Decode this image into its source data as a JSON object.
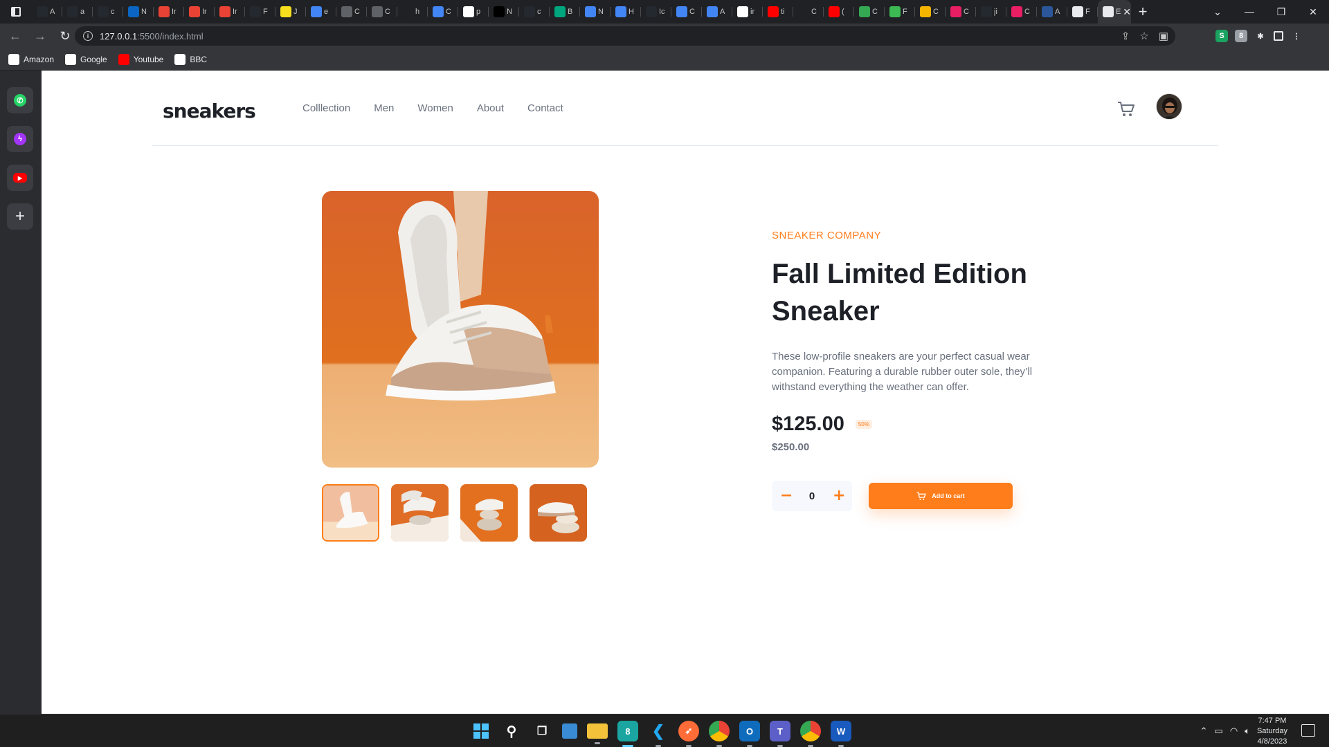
{
  "browser": {
    "tabs": [
      {
        "label": "A",
        "icon": "github-icon",
        "color": "#24292f"
      },
      {
        "label": "a",
        "icon": "github-icon",
        "color": "#24292f"
      },
      {
        "label": "c",
        "icon": "github-icon",
        "color": "#24292f"
      },
      {
        "label": "N",
        "icon": "linkedin-icon",
        "color": "#0a66c2"
      },
      {
        "label": "Ir",
        "icon": "gmail-icon",
        "color": "#ea4335"
      },
      {
        "label": "Ir",
        "icon": "gmail-icon",
        "color": "#ea4335"
      },
      {
        "label": "Ir",
        "icon": "gmail-icon",
        "color": "#ea4335"
      },
      {
        "label": "F",
        "icon": "github-icon",
        "color": "#24292f"
      },
      {
        "label": "J",
        "icon": "js-icon",
        "color": "#f7df1e"
      },
      {
        "label": "e",
        "icon": "globe-icon",
        "color": "#4285f4"
      },
      {
        "label": "C",
        "icon": "doc-icon",
        "color": "#5f6368"
      },
      {
        "label": "C",
        "icon": "doc-icon",
        "color": "#5f6368"
      },
      {
        "label": "h",
        "icon": "blank-icon",
        "color": "#202124"
      },
      {
        "label": "C",
        "icon": "docs-icon",
        "color": "#4285f4"
      },
      {
        "label": "p",
        "icon": "google-icon",
        "color": "#ffffff"
      },
      {
        "label": "N",
        "icon": "dev-icon",
        "color": "#000000"
      },
      {
        "label": "c",
        "icon": "github-icon",
        "color": "#24292f"
      },
      {
        "label": "B",
        "icon": "bolt-icon",
        "color": "#00a67e"
      },
      {
        "label": "N",
        "icon": "globe-icon",
        "color": "#4285f4"
      },
      {
        "label": "H",
        "icon": "globe-icon",
        "color": "#4285f4"
      },
      {
        "label": "Ic",
        "icon": "github-icon",
        "color": "#24292f"
      },
      {
        "label": "C",
        "icon": "globe-icon",
        "color": "#4285f4"
      },
      {
        "label": "A",
        "icon": "docs-icon",
        "color": "#4285f4"
      },
      {
        "label": "ir",
        "icon": "google-icon",
        "color": "#ffffff"
      },
      {
        "label": "ti",
        "icon": "youtube-icon",
        "color": "#ff0000"
      },
      {
        "label": "C",
        "icon": "a-icon",
        "color": "#202124"
      },
      {
        "label": "(",
        "icon": "youtube-icon",
        "color": "#ff0000"
      },
      {
        "label": "C",
        "icon": "image-icon",
        "color": "#34a853"
      },
      {
        "label": "F",
        "icon": "frog-icon",
        "color": "#3cba54"
      },
      {
        "label": "C",
        "icon": "trophy-icon",
        "color": "#f4b400"
      },
      {
        "label": "C",
        "icon": "play-icon",
        "color": "#e91e63"
      },
      {
        "label": "ji",
        "icon": "github-icon",
        "color": "#24292f"
      },
      {
        "label": "C",
        "icon": "play-icon",
        "color": "#e91e63"
      },
      {
        "label": "A",
        "icon": "word-icon",
        "color": "#2b579a"
      },
      {
        "label": "F",
        "icon": "page-icon",
        "color": "#e8eaed"
      }
    ],
    "active_tab": {
      "label": "E",
      "icon": "page-icon"
    },
    "url_host": "127.0.0.1",
    "url_rest": ":5500/index.html",
    "bookmarks": [
      {
        "label": "Amazon",
        "icon": "amazon-icon",
        "color": "#ffffff"
      },
      {
        "label": "Google",
        "icon": "google-icon",
        "color": "#ffffff"
      },
      {
        "label": "Youtube",
        "icon": "youtube-icon",
        "color": "#ff0000"
      },
      {
        "label": "BBC",
        "icon": "bbc-icon",
        "color": "#ffffff"
      }
    ],
    "sidebar": [
      "whatsapp-icon",
      "messenger-icon",
      "youtube-icon",
      "plus-icon"
    ]
  },
  "site": {
    "logo": "sneakers",
    "nav": [
      "Colllection",
      "Men",
      "Women",
      "About",
      "Contact"
    ]
  },
  "product": {
    "company": "SNEAKER COMPANY",
    "title": "Fall Limited Edition Sneaker",
    "description": "These low-profile sneakers are your perfect casual wear companion. Featuring a durable rubber outer sole, they’ll withstand everything the weather can offer.",
    "price": "$125.00",
    "discount": "50%",
    "old_price": "$250.00",
    "quantity": "0",
    "minus": "−",
    "plus": "+",
    "add_to_cart": "Add to cart"
  },
  "taskbar": {
    "time": "7:47 PM",
    "day": "Saturday",
    "date": "4/8/2023"
  },
  "colors": {
    "accent": "#ff7d1a",
    "text_dark": "#1d2026",
    "text_grey": "#69707d"
  }
}
